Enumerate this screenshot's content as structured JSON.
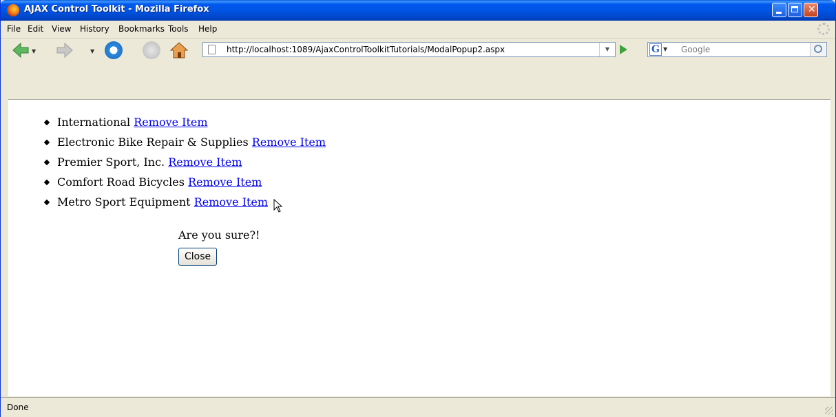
{
  "window": {
    "title": "AJAX Control Toolkit - Mozilla Firefox"
  },
  "menu": [
    "File",
    "Edit",
    "View",
    "History",
    "Bookmarks",
    "Tools",
    "Help"
  ],
  "navigation": {
    "url": "http://localhost:1089/AjaxControlToolkitTutorials/ModalPopup2.aspx",
    "search_placeholder": "Google",
    "search_engine_icon": "G"
  },
  "page": {
    "items": [
      {
        "name": "International",
        "link": "Remove Item"
      },
      {
        "name": "Electronic Bike Repair & Supplies",
        "link": "Remove Item"
      },
      {
        "name": "Premier Sport, Inc.",
        "link": "Remove Item"
      },
      {
        "name": "Comfort Road Bicycles",
        "link": "Remove Item"
      },
      {
        "name": "Metro Sport Equipment",
        "link": "Remove Item"
      }
    ],
    "popup_text": "Are you sure?!",
    "close_label": "Close"
  },
  "status": {
    "text": "Done"
  },
  "colors": {
    "link": "#0000ee",
    "titlebar": "#0055e5"
  }
}
